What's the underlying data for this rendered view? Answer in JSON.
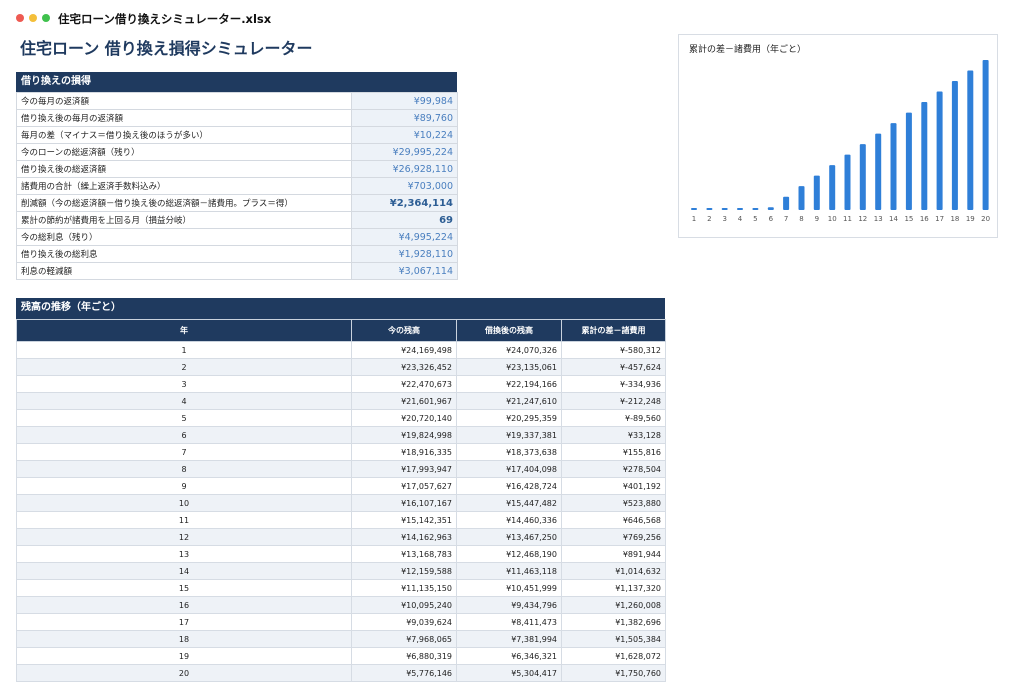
{
  "window": {
    "title": "住宅ローン借り換えシミュレーター.xlsx",
    "controls": [
      {
        "name": "close",
        "color": "#ee5a52"
      },
      {
        "name": "minimize",
        "color": "#f4bf3a"
      },
      {
        "name": "maximize",
        "color": "#3fc14d"
      }
    ]
  },
  "sheet": {
    "title": "住宅ローン 借り換え損得シミュレーター"
  },
  "refinance": {
    "heading": "借り換えの損得",
    "rows": [
      {
        "label": "今の毎月の返済額",
        "value": "¥99,984",
        "bold": false
      },
      {
        "label": "借り換え後の毎月の返済額",
        "value": "¥89,760",
        "bold": false
      },
      {
        "label": "毎月の差（マイナス＝借り換え後のほうが多い）",
        "value": "¥10,224",
        "bold": false
      },
      {
        "label": "今のローンの総返済額（残り）",
        "value": "¥29,995,224",
        "bold": false
      },
      {
        "label": "借り換え後の総返済額",
        "value": "¥26,928,110",
        "bold": false
      },
      {
        "label": "諸費用の合計（繰上返済手数料込み）",
        "value": "¥703,000",
        "bold": false
      },
      {
        "label": "削減額（今の総返済額－借り換え後の総返済額－諸費用。プラス＝得）",
        "value": "¥2,364,114",
        "bold": true
      },
      {
        "label": "累計の節約が諸費用を上回る月（損益分岐）",
        "value": "69",
        "bold": true
      },
      {
        "label": "今の総利息（残り）",
        "value": "¥4,995,224",
        "bold": false
      },
      {
        "label": "借り換え後の総利息",
        "value": "¥1,928,110",
        "bold": false
      },
      {
        "label": "利息の軽減額",
        "value": "¥3,067,114",
        "bold": false
      }
    ]
  },
  "yearly": {
    "heading": "残高の推移（年ごと）",
    "columns": [
      "年",
      "今の残高",
      "借換後の残高",
      "累計の差－諸費用"
    ],
    "rows": [
      [
        "1",
        "¥24,169,498",
        "¥24,070,326",
        "¥-580,312"
      ],
      [
        "2",
        "¥23,326,452",
        "¥23,135,061",
        "¥-457,624"
      ],
      [
        "3",
        "¥22,470,673",
        "¥22,194,166",
        "¥-334,936"
      ],
      [
        "4",
        "¥21,601,967",
        "¥21,247,610",
        "¥-212,248"
      ],
      [
        "5",
        "¥20,720,140",
        "¥20,295,359",
        "¥-89,560"
      ],
      [
        "6",
        "¥19,824,998",
        "¥19,337,381",
        "¥33,128"
      ],
      [
        "7",
        "¥18,916,335",
        "¥18,373,638",
        "¥155,816"
      ],
      [
        "8",
        "¥17,993,947",
        "¥17,404,098",
        "¥278,504"
      ],
      [
        "9",
        "¥17,057,627",
        "¥16,428,724",
        "¥401,192"
      ],
      [
        "10",
        "¥16,107,167",
        "¥15,447,482",
        "¥523,880"
      ],
      [
        "11",
        "¥15,142,351",
        "¥14,460,336",
        "¥646,568"
      ],
      [
        "12",
        "¥14,162,963",
        "¥13,467,250",
        "¥769,256"
      ],
      [
        "13",
        "¥13,168,783",
        "¥12,468,190",
        "¥891,944"
      ],
      [
        "14",
        "¥12,159,588",
        "¥11,463,118",
        "¥1,014,632"
      ],
      [
        "15",
        "¥11,135,150",
        "¥10,451,999",
        "¥1,137,320"
      ],
      [
        "16",
        "¥10,095,240",
        "¥9,434,796",
        "¥1,260,008"
      ],
      [
        "17",
        "¥9,039,624",
        "¥8,411,473",
        "¥1,382,696"
      ],
      [
        "18",
        "¥7,968,065",
        "¥7,381,994",
        "¥1,505,384"
      ],
      [
        "19",
        "¥6,880,319",
        "¥6,346,321",
        "¥1,628,072"
      ],
      [
        "20",
        "¥5,776,146",
        "¥5,304,417",
        "¥1,750,760"
      ]
    ]
  },
  "chart_data": {
    "type": "bar",
    "title": "累計の差－諸費用（年ごと）",
    "categories": [
      "1",
      "2",
      "3",
      "4",
      "5",
      "6",
      "7",
      "8",
      "9",
      "10",
      "11",
      "12",
      "13",
      "14",
      "15",
      "16",
      "17",
      "18",
      "19",
      "20"
    ],
    "values": [
      -580312,
      -457624,
      -334936,
      -212248,
      -89560,
      33128,
      155816,
      278504,
      401192,
      523880,
      646568,
      769256,
      891944,
      1014632,
      1137320,
      1260008,
      1382696,
      1505384,
      1628072,
      1750760
    ],
    "color": "#2f7fd8",
    "ylim": [
      0,
      1750760
    ],
    "grid": false,
    "legend": "none"
  },
  "colors": {
    "header_bg": "#1f3a5f",
    "value_bg": "#edf2f8",
    "value_text": "#4a7fbf",
    "bar": "#2f7fd8"
  }
}
